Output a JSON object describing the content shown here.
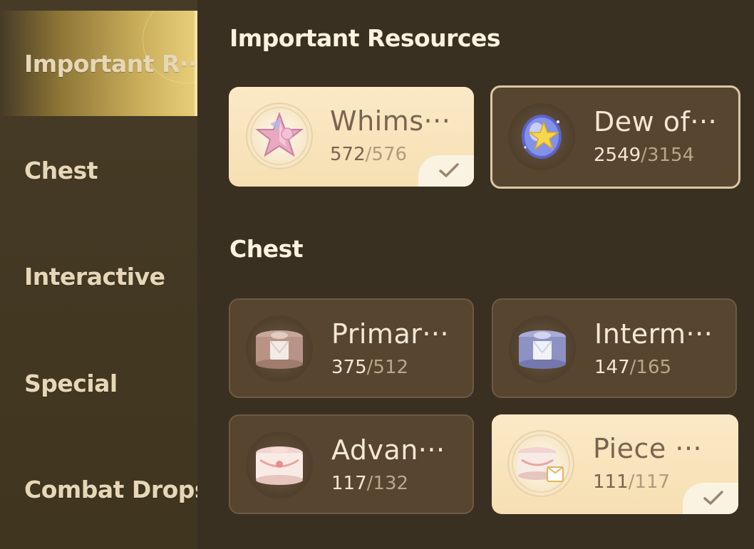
{
  "sidebar": {
    "items": [
      {
        "label": "Important R···",
        "active": true
      },
      {
        "label": "Chest",
        "active": false
      },
      {
        "label": "Interactive",
        "active": false
      },
      {
        "label": "Special",
        "active": false
      },
      {
        "label": "Combat Drops",
        "active": false
      }
    ]
  },
  "sections": [
    {
      "title": "Important Resources",
      "cards": [
        {
          "name": "Whims···",
          "current": "572",
          "max": "576",
          "completed": true,
          "style": "light",
          "icon": "star-gem-icon"
        },
        {
          "name": "Dew of···",
          "current": "2549",
          "max": "3154",
          "completed": false,
          "style": "dark-selected",
          "icon": "dew-orb-icon"
        }
      ]
    },
    {
      "title": "Chest",
      "cards": [
        {
          "name": "Primar···",
          "current": "375",
          "max": "512",
          "completed": false,
          "style": "dark",
          "icon": "primary-chest-icon"
        },
        {
          "name": "Interm···",
          "current": "147",
          "max": "165",
          "completed": false,
          "style": "dark",
          "icon": "intermediate-chest-icon"
        },
        {
          "name": "Advan···",
          "current": "117",
          "max": "132",
          "completed": false,
          "style": "dark",
          "icon": "advanced-chest-icon"
        },
        {
          "name": "Piece ···",
          "current": "111",
          "max": "117",
          "completed": true,
          "style": "light",
          "icon": "piece-chest-icon"
        }
      ]
    }
  ],
  "separator": "/",
  "colors": {
    "accent_gold": "#e9cf7c",
    "background": "#3a3021",
    "sidebar": "#463b27"
  }
}
